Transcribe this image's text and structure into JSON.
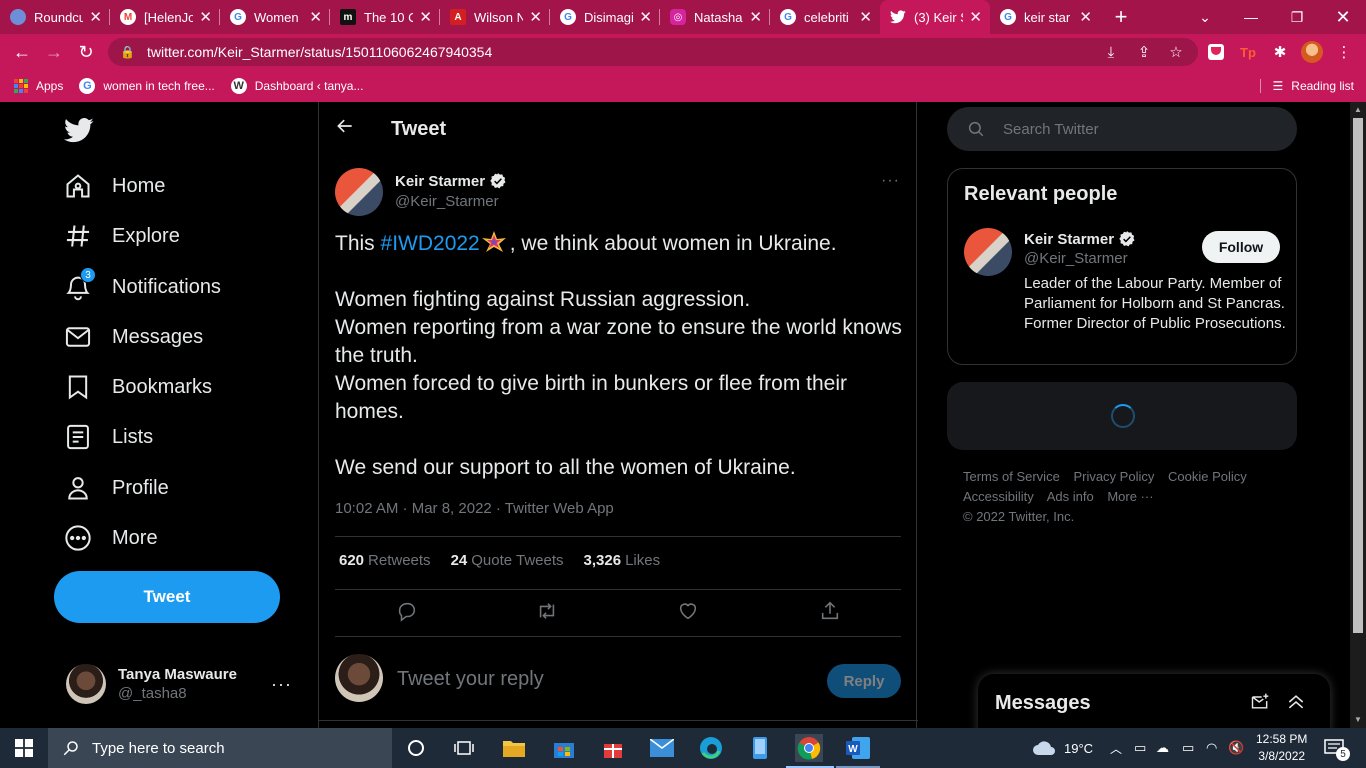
{
  "browser": {
    "tabs": [
      {
        "label": "Roundcu",
        "fav_color": "#6e8fd8",
        "fav_glyph": ""
      },
      {
        "label": "[HelenJo",
        "fav_color": "#ea4335",
        "fav_glyph": "M"
      },
      {
        "label": "Women",
        "fav_color": "#ffffff",
        "fav_glyph": "G"
      },
      {
        "label": "The 10 C",
        "fav_color": "#111111",
        "fav_glyph": "m"
      },
      {
        "label": "Wilson N",
        "fav_color": "#d31f1f",
        "fav_glyph": "A"
      },
      {
        "label": "Disimagi",
        "fav_color": "#ffffff",
        "fav_glyph": "G"
      },
      {
        "label": "Natasha",
        "fav_color": "#d6249f",
        "fav_glyph": "◎"
      },
      {
        "label": "celebriti",
        "fav_color": "#ffffff",
        "fav_glyph": "G"
      },
      {
        "label": "(3) Keir S",
        "fav_color": "#1d9bf0",
        "fav_glyph": "t",
        "active": true
      },
      {
        "label": "keir star",
        "fav_color": "#ffffff",
        "fav_glyph": "G"
      }
    ],
    "url": "twitter.com/Keir_Starmer/status/1501106062467940354",
    "bookmarks": [
      "Apps",
      "women in tech free...",
      "Dashboard ‹ tanya..."
    ],
    "reading_list": "Reading list",
    "accent": "#c5185a"
  },
  "nav": {
    "items": [
      {
        "label": "Home",
        "icon": "home-icon"
      },
      {
        "label": "Explore",
        "icon": "hashtag-icon"
      },
      {
        "label": "Notifications",
        "icon": "bell-icon",
        "badge": "3"
      },
      {
        "label": "Messages",
        "icon": "mail-icon"
      },
      {
        "label": "Bookmarks",
        "icon": "bookmark-icon"
      },
      {
        "label": "Lists",
        "icon": "list-icon"
      },
      {
        "label": "Profile",
        "icon": "person-icon"
      },
      {
        "label": "More",
        "icon": "more-circle-icon"
      }
    ],
    "tweet_button": "Tweet",
    "account": {
      "name": "Tanya Maswaure",
      "handle": "@_tasha8"
    }
  },
  "main": {
    "header": "Tweet",
    "tweet": {
      "author_name": "Keir Starmer",
      "author_handle": "@Keir_Starmer",
      "line1_pre": "This ",
      "hashtag": "#IWD2022",
      "line1_post": ", we think about women in Ukraine.",
      "para2": [
        "Women fighting against Russian aggression.",
        "Women reporting from a war zone to ensure the world knows the truth.",
        "Women forced to give birth in bunkers or flee from their homes."
      ],
      "para3": "We send our support to all the women of Ukraine.",
      "meta": "10:02 AM · Mar 8, 2022 · Twitter Web App",
      "retweets": "620",
      "retweets_label": "Retweets",
      "quotes": "24",
      "quotes_label": "Quote Tweets",
      "likes": "3,326",
      "likes_label": "Likes"
    },
    "reply_placeholder": "Tweet your reply",
    "reply_button": "Reply"
  },
  "right": {
    "search_placeholder": "Search Twitter",
    "relevant_header": "Relevant people",
    "person": {
      "name": "Keir Starmer",
      "handle": "@Keir_Starmer",
      "bio": "Leader of the Labour Party. Member of Parliament for Holborn and St Pancras. Former Director of Public Prosecutions.",
      "follow_label": "Follow"
    },
    "footer": {
      "links": [
        "Terms of Service",
        "Privacy Policy",
        "Cookie Policy",
        "Accessibility",
        "Ads info",
        "More ···"
      ],
      "copyright": "© 2022 Twitter, Inc."
    },
    "messages_drawer": "Messages"
  },
  "taskbar": {
    "search_placeholder": "Type here to search",
    "weather": "19°C",
    "time": "12:58 PM",
    "date": "3/8/2022",
    "notif_count": "5"
  }
}
